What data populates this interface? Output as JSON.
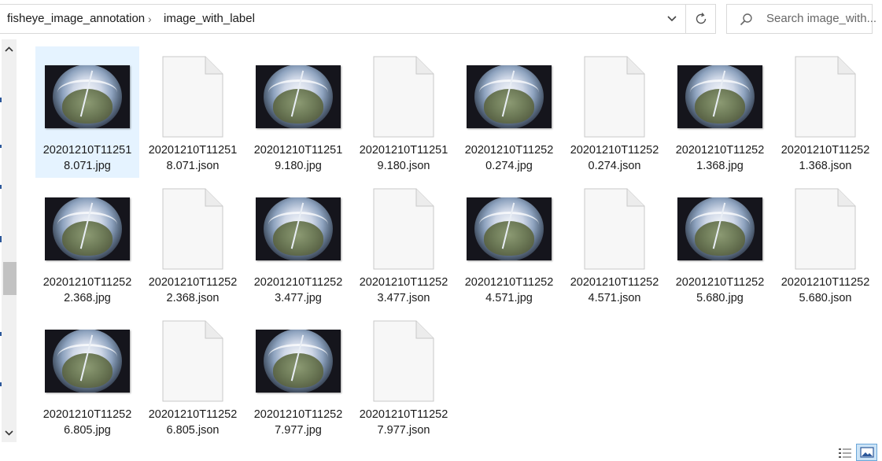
{
  "address_bar": {
    "path": [
      "fisheye_image_annotation",
      "image_with_label"
    ],
    "separator": "›"
  },
  "search": {
    "placeholder": "Search image_with..."
  },
  "icons": {
    "dropdown": "chevron-down-icon",
    "refresh": "refresh-icon",
    "search": "search-icon",
    "scroll_up": "chevron-up-icon",
    "scroll_down": "chevron-down-icon",
    "details_view": "details-view-icon",
    "large_icons_view": "large-icons-view-icon"
  },
  "colors": {
    "selection": "#e5f3ff",
    "accent": "#2b579a",
    "view_active": "#cce4f7"
  },
  "files": [
    {
      "line1": "20201210T11251",
      "line2": "8.071.jpg",
      "type": "image",
      "selected": true
    },
    {
      "line1": "20201210T11251",
      "line2": "8.071.json",
      "type": "json"
    },
    {
      "line1": "20201210T11251",
      "line2": "9.180.jpg",
      "type": "image"
    },
    {
      "line1": "20201210T11251",
      "line2": "9.180.json",
      "type": "json"
    },
    {
      "line1": "20201210T11252",
      "line2": "0.274.jpg",
      "type": "image"
    },
    {
      "line1": "20201210T11252",
      "line2": "0.274.json",
      "type": "json"
    },
    {
      "line1": "20201210T11252",
      "line2": "1.368.jpg",
      "type": "image"
    },
    {
      "line1": "20201210T11252",
      "line2": "1.368.json",
      "type": "json"
    },
    {
      "line1": "20201210T11252",
      "line2": "2.368.jpg",
      "type": "image"
    },
    {
      "line1": "20201210T11252",
      "line2": "2.368.json",
      "type": "json"
    },
    {
      "line1": "20201210T11252",
      "line2": "3.477.jpg",
      "type": "image"
    },
    {
      "line1": "20201210T11252",
      "line2": "3.477.json",
      "type": "json"
    },
    {
      "line1": "20201210T11252",
      "line2": "4.571.jpg",
      "type": "image"
    },
    {
      "line1": "20201210T11252",
      "line2": "4.571.json",
      "type": "json"
    },
    {
      "line1": "20201210T11252",
      "line2": "5.680.jpg",
      "type": "image"
    },
    {
      "line1": "20201210T11252",
      "line2": "5.680.json",
      "type": "json"
    },
    {
      "line1": "20201210T11252",
      "line2": "6.805.jpg",
      "type": "image"
    },
    {
      "line1": "20201210T11252",
      "line2": "6.805.json",
      "type": "json"
    },
    {
      "line1": "20201210T11252",
      "line2": "7.977.jpg",
      "type": "image"
    },
    {
      "line1": "20201210T11252",
      "line2": "7.977.json",
      "type": "json"
    }
  ]
}
